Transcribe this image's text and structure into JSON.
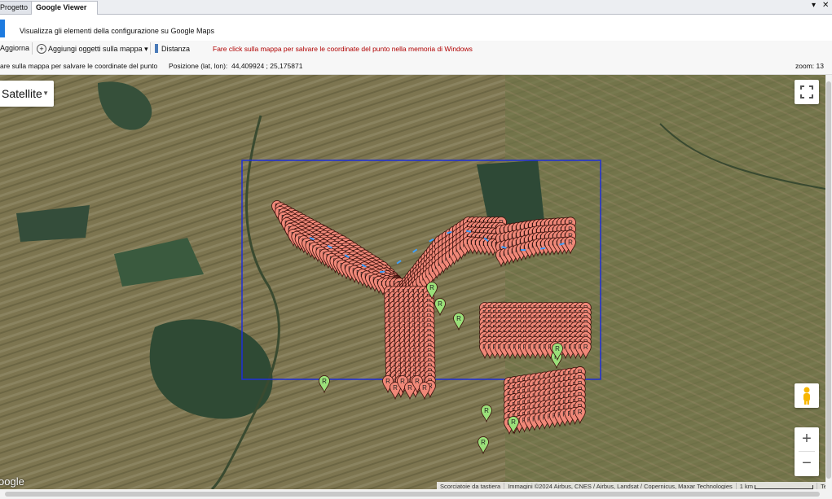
{
  "tabs": [
    {
      "label": "Progetto"
    },
    {
      "label": "Google Viewer"
    }
  ],
  "tab_controls": {
    "dropdown": "▾",
    "close": "✕"
  },
  "header": {
    "description": "Visualizza gli elementi della configurazione su Google Maps"
  },
  "toolbar": {
    "refresh_label": "Aggiorna",
    "add_objects_label": "Aggiungi oggetti sulla mappa",
    "distance_label": "Distanza",
    "warning_text": "Fare click sulla mappa per salvare le coordinate del punto nella memoria di Windows"
  },
  "status": {
    "hint": "are sulla mappa per salvare le coordinate del punto",
    "position_label": "Posizione (lat, lon):",
    "position_value": "44,409924 ; 25,175871",
    "zoom": "zoom: 13"
  },
  "map": {
    "map_type_label": "Satellite",
    "google_logo": "oogle",
    "attribution": {
      "shortcuts": "Scorciatoie da tastiera",
      "imagery": "Immagini ©2024 Airbus, CNES / Airbus, Landsat / Copernicus, Maxar Technologies",
      "scale": "1 km",
      "terms": "Termini"
    },
    "marker_letter": "R",
    "colors": {
      "red_marker": "#f08878",
      "green_marker": "#9be07a",
      "selection_rect": "#1f2fd6",
      "route": "#3fa0ff"
    }
  }
}
